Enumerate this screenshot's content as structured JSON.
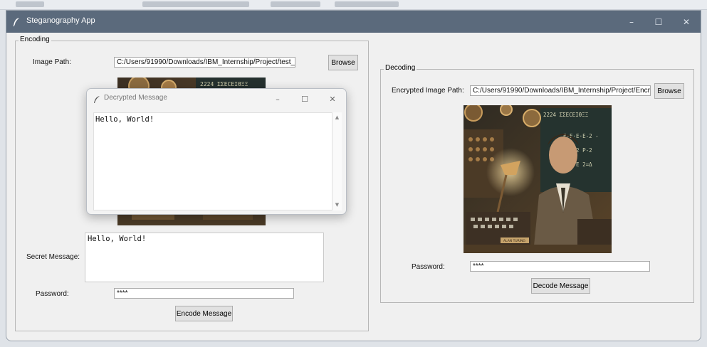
{
  "main_window": {
    "title": "Steganography App",
    "icon": "feather-icon",
    "controls": {
      "minimize": "–",
      "maximize": "☐",
      "close": "✕"
    }
  },
  "encoding": {
    "frame_title": "Encoding",
    "image_path_label": "Image Path:",
    "image_path_value": "C:/Users/91990/Downloads/IBM_Internship/Project/test_i",
    "browse_label": "Browse",
    "secret_message_label": "Secret Message:",
    "secret_message_value": "Hello, World!",
    "password_label": "Password:",
    "password_value": "****",
    "encode_button": "Encode Message"
  },
  "decoding": {
    "frame_title": "Decoding",
    "image_path_label": "Encrypted Image Path:",
    "image_path_value": "C:/Users/91990/Downloads/IBM_Internship/Project/Encry",
    "browse_label": "Browse",
    "password_label": "Password:",
    "password_value": "****",
    "decode_button": "Decode Message"
  },
  "popup": {
    "title": "Decrypted Message",
    "icon": "feather-icon",
    "message": "Hello, World!",
    "controls": {
      "minimize": "–",
      "maximize": "☐",
      "close": "✕"
    }
  },
  "image_art": {
    "board_text_1": "2224 ΣΣΕCΕΙΘΞΞ",
    "board_text_2": "Ε-Ε·Ε·Ε-2 -",
    "board_text_3": "Ε=Α·2 Ρ-2",
    "board_text_4": "2=2 Ε 2=Δ",
    "plaque_text": "ALAN TURING"
  },
  "colors": {
    "titlebar": "#5b6a7c",
    "window_bg": "#f0f0f0",
    "accent": "#b9874a"
  }
}
